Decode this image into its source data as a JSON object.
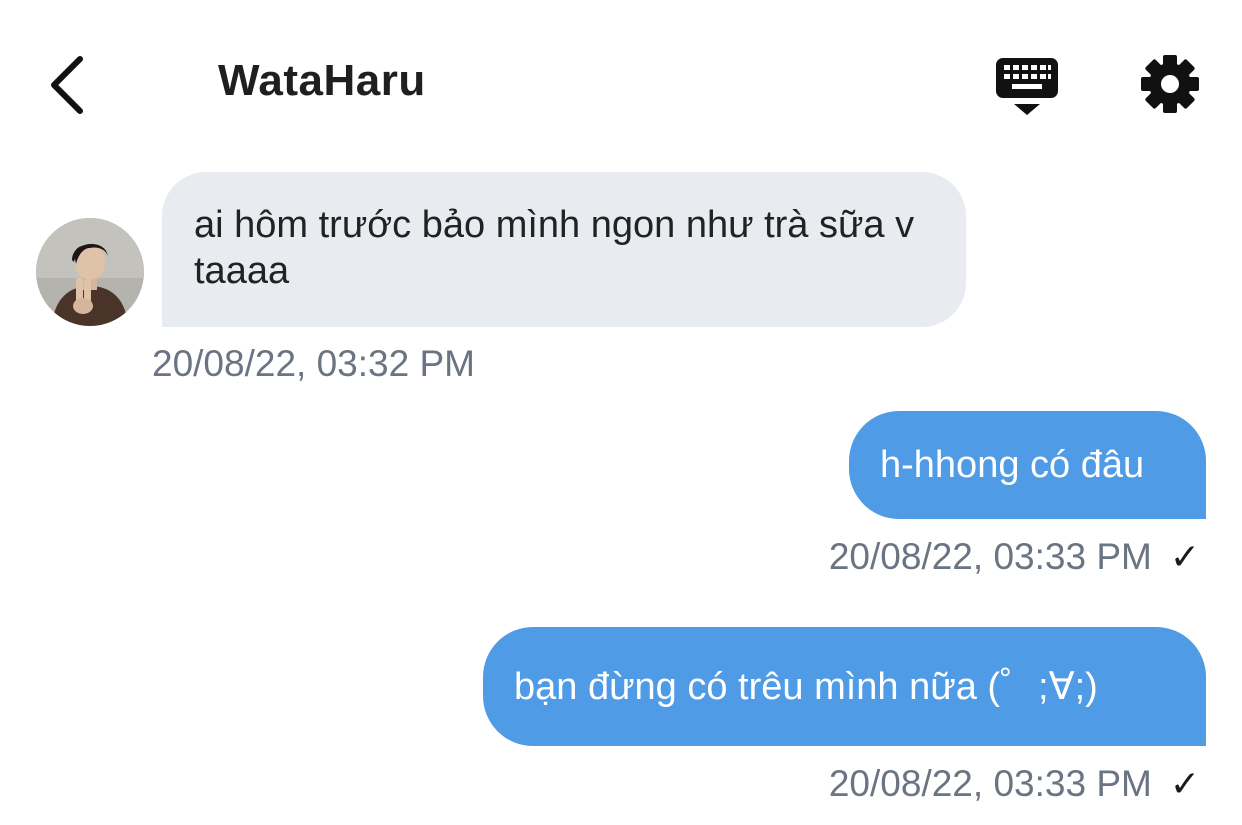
{
  "header": {
    "title": "WataHaru",
    "back_icon": "chevron-left-icon",
    "keyboard_icon": "keyboard-hide-icon",
    "settings_icon": "gear-icon"
  },
  "messages": [
    {
      "direction": "incoming",
      "text": "ai hôm trước bảo mình ngon như trà sữa v taaaa",
      "timestamp": "20/08/22, 03:32 PM"
    },
    {
      "direction": "outgoing",
      "text": "h-hhong có đâu",
      "timestamp": "20/08/22, 03:33 PM",
      "status": "✓"
    },
    {
      "direction": "outgoing",
      "text": "bạn đừng có trêu mình nữa (゜;∀;)",
      "timestamp": "20/08/22, 03:33 PM",
      "status": "✓"
    }
  ],
  "colors": {
    "incoming_bubble": "#e8ebf0",
    "outgoing_bubble": "#4f9be6",
    "timestamp": "#6b7482",
    "title": "#1f1f1f"
  }
}
